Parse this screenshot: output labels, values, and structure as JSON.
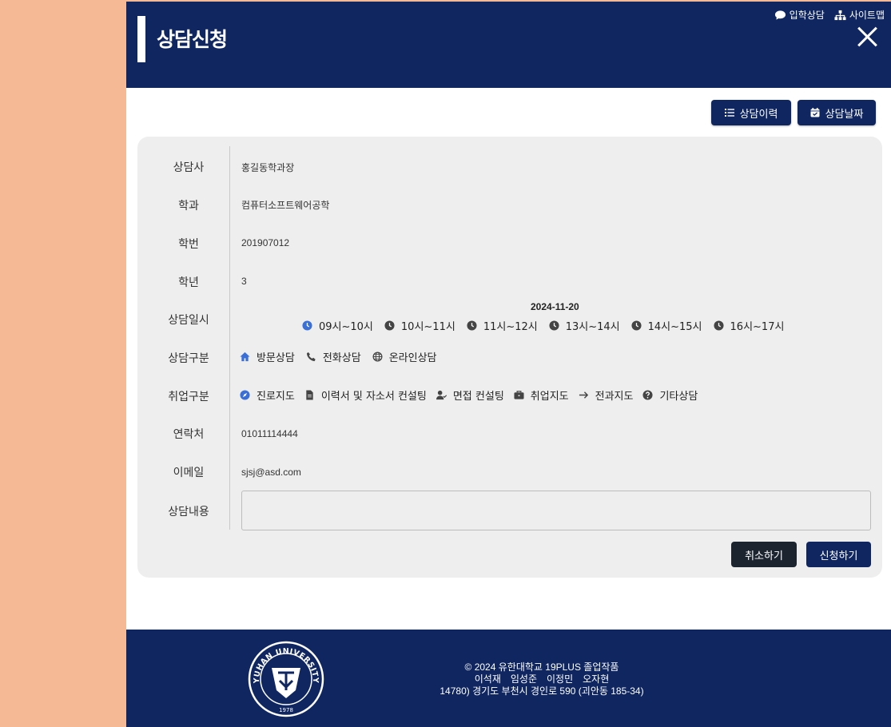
{
  "header": {
    "title": "상담신청",
    "links": [
      {
        "label": "입학상담",
        "icon": "chat-bubble-icon"
      },
      {
        "label": "사이트맵",
        "icon": "sitemap-icon"
      }
    ]
  },
  "toolbar": {
    "history_label": "상담이력",
    "date_label": "상담날짜"
  },
  "form": {
    "counselor": {
      "label": "상담사",
      "value": "홍길동학과장"
    },
    "department": {
      "label": "학과",
      "value": "컴퓨터소프트웨어공학"
    },
    "student_id": {
      "label": "학번",
      "value": "201907012"
    },
    "grade": {
      "label": "학년",
      "value": "3"
    },
    "datetime": {
      "label": "상담일시",
      "date": "2024-11-20",
      "slots": [
        "09시~10시",
        "10시~11시",
        "11시~12시",
        "13시~14시",
        "14시~15시",
        "16시~17시"
      ],
      "selected_slot": "09시~10시"
    },
    "method": {
      "label": "상담구분",
      "options": [
        "방문상담",
        "전화상담",
        "온라인상담"
      ],
      "selected": "방문상담"
    },
    "career": {
      "label": "취업구분",
      "options": [
        "진로지도",
        "이력서 및 자소서 컨설팅",
        "면접 컨설팅",
        "취업지도",
        "전과지도",
        "기타상담"
      ],
      "selected": "진로지도"
    },
    "contact": {
      "label": "연락처",
      "value": "01011114444"
    },
    "email": {
      "label": "이메일",
      "value": "sjsj@asd.com"
    },
    "content": {
      "label": "상담내용",
      "value": ""
    }
  },
  "actions": {
    "cancel_label": "취소하기",
    "submit_label": "신청하기"
  },
  "footer": {
    "copyright": "© 2024 유한대학교 19PLUS 졸업작품",
    "members": [
      "이석재",
      "임성준",
      "이정민",
      "오자현"
    ],
    "address": "14780) 경기도 부천시 경인로 590 (괴안동 185-34)",
    "seal_text": "YUHAN UNIVERSITY",
    "seal_year": "1978"
  },
  "colors": {
    "navy": "#0f2660",
    "card": "#eeeeee",
    "selected_icon": "#3a6fd8",
    "dark_button": "#1c2430"
  }
}
